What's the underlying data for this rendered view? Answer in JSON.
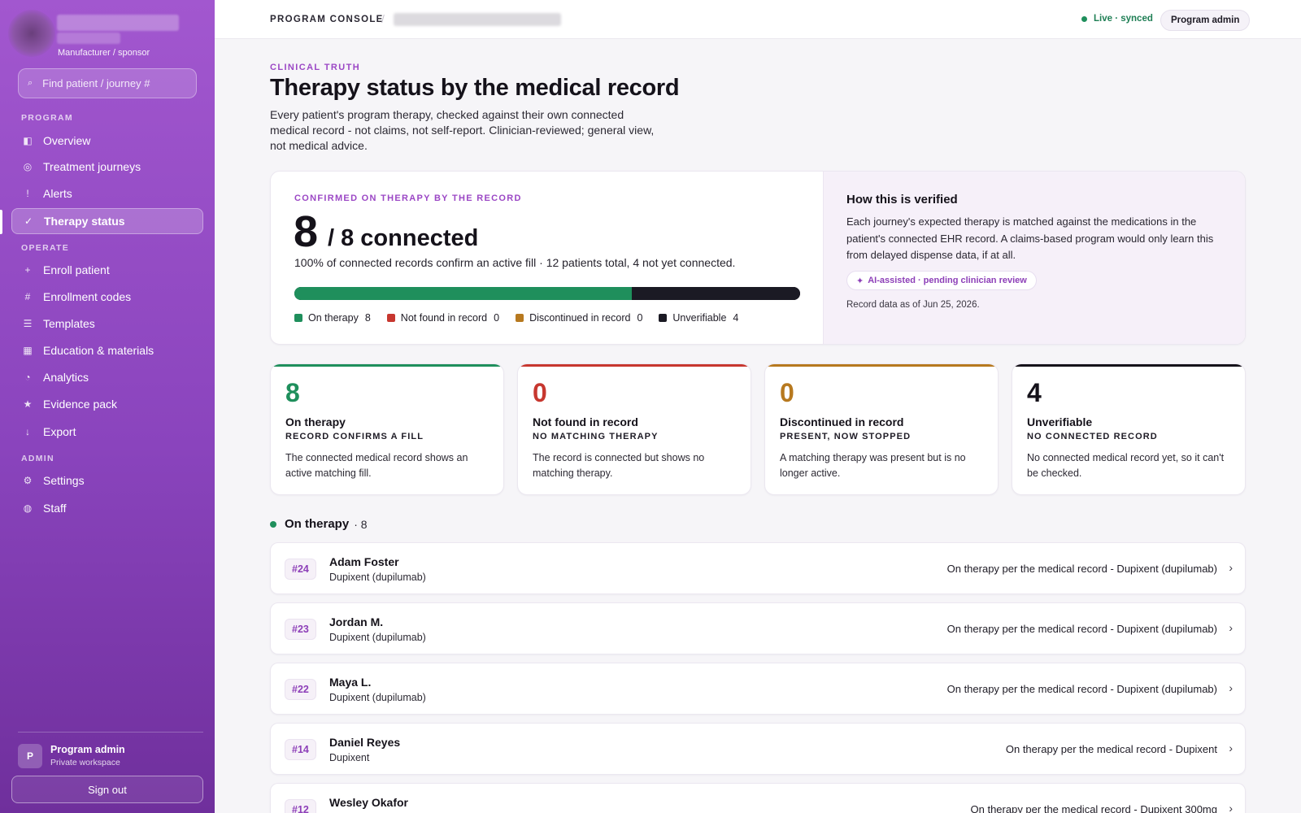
{
  "sidebar": {
    "org_sub": "Manufacturer / sponsor",
    "search_placeholder": "Find patient / journey #",
    "sections": {
      "program": "PROGRAM",
      "operate": "OPERATE",
      "admin": "ADMIN"
    },
    "items": [
      {
        "label": "Overview",
        "icon": "panel-icon"
      },
      {
        "label": "Treatment journeys",
        "icon": "target-icon"
      },
      {
        "label": "Alerts",
        "icon": "exclamation-icon"
      },
      {
        "label": "Therapy status",
        "icon": "check-icon"
      },
      {
        "label": "Enroll patient",
        "icon": "plus-icon"
      },
      {
        "label": "Enrollment codes",
        "icon": "hash-icon"
      },
      {
        "label": "Templates",
        "icon": "list-icon"
      },
      {
        "label": "Education & materials",
        "icon": "grid-icon"
      },
      {
        "label": "Analytics",
        "icon": "pie-icon"
      },
      {
        "label": "Evidence pack",
        "icon": "star-icon"
      },
      {
        "label": "Export",
        "icon": "arrow-down-icon"
      },
      {
        "label": "Settings",
        "icon": "gear-icon"
      },
      {
        "label": "Staff",
        "icon": "people-icon"
      }
    ],
    "active_item": "Therapy status",
    "user": {
      "initial": "P",
      "name": "Program admin",
      "sub": "Private workspace"
    },
    "sign_out": "Sign out"
  },
  "topbar": {
    "breadcrumb": "PROGRAM CONSOLE",
    "separator": "/",
    "status": "Live · synced",
    "role": "Program admin"
  },
  "page": {
    "eyebrow": "CLINICAL TRUTH",
    "title": "Therapy status by the medical record",
    "description": "Every patient's program therapy, checked against their own connected medical record - not claims, not self-report. Clinician-reviewed; general view, not medical advice."
  },
  "summary": {
    "eyebrow": "CONFIRMED ON THERAPY BY THE RECORD",
    "confirmed": "8",
    "suffix": "/ 8 connected",
    "line": "100% of connected records confirm an active fill · 12 patients total, 4 not yet connected.",
    "breakdown": [
      {
        "label": "On therapy",
        "count": 8,
        "color": "#1f8f5c"
      },
      {
        "label": "Not found in record",
        "count": 0,
        "color": "#c7372f"
      },
      {
        "label": "Discontinued in record",
        "count": 0,
        "color": "#b7791f"
      },
      {
        "label": "Unverifiable",
        "count": 4,
        "color": "#1b1a24"
      }
    ],
    "verify_title": "How this is verified",
    "verify_text": "Each journey's expected therapy is matched against the medications in the patient's connected EHR record. A claims-based program would only learn this from delayed dispense data, if at all.",
    "ai_chip": "AI-assisted · pending clinician review",
    "record_date": "Record data as of Jun 25, 2026."
  },
  "stats": [
    {
      "num": "8",
      "label": "On therapy",
      "sub": "RECORD CONFIRMS A FILL",
      "desc": "The connected medical record shows an active matching fill.",
      "color": "#1f8f5c"
    },
    {
      "num": "0",
      "label": "Not found in record",
      "sub": "NO MATCHING THERAPY",
      "desc": "The record is connected but shows no matching therapy.",
      "color": "#c7372f"
    },
    {
      "num": "0",
      "label": "Discontinued in record",
      "sub": "PRESENT, NOW STOPPED",
      "desc": "A matching therapy was present but is no longer active.",
      "color": "#b7791f"
    },
    {
      "num": "4",
      "label": "Unverifiable",
      "sub": "NO CONNECTED RECORD",
      "desc": "No connected medical record yet, so it can't be checked.",
      "color": "#15121a"
    }
  ],
  "group": {
    "label": "On therapy",
    "count": "· 8"
  },
  "rows": [
    {
      "id": "#24",
      "name": "Adam Foster",
      "drug": "Dupixent (dupilumab)",
      "status": "On therapy per the medical record - Dupixent (dupilumab)"
    },
    {
      "id": "#23",
      "name": "Jordan M.",
      "drug": "Dupixent (dupilumab)",
      "status": "On therapy per the medical record - Dupixent (dupilumab)"
    },
    {
      "id": "#22",
      "name": "Maya L.",
      "drug": "Dupixent (dupilumab)",
      "status": "On therapy per the medical record - Dupixent (dupilumab)"
    },
    {
      "id": "#14",
      "name": "Daniel Reyes",
      "drug": "Dupixent",
      "status": "On therapy per the medical record - Dupixent"
    },
    {
      "id": "#12",
      "name": "Wesley Okafor",
      "drug": "",
      "status": "On therapy per the medical record - Dupixent 300mg"
    }
  ]
}
